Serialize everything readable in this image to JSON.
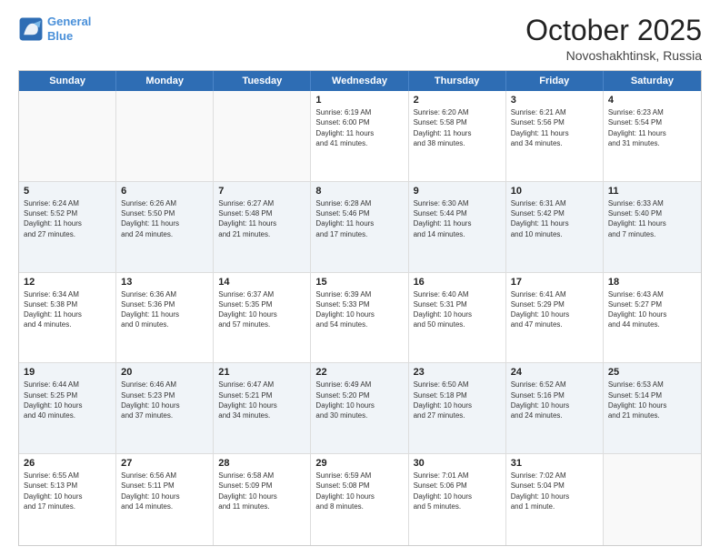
{
  "header": {
    "logo_line1": "General",
    "logo_line2": "Blue",
    "month": "October 2025",
    "location": "Novoshakhtinsk, Russia"
  },
  "day_headers": [
    "Sunday",
    "Monday",
    "Tuesday",
    "Wednesday",
    "Thursday",
    "Friday",
    "Saturday"
  ],
  "weeks": [
    {
      "alt": false,
      "days": [
        {
          "date": "",
          "info": ""
        },
        {
          "date": "",
          "info": ""
        },
        {
          "date": "",
          "info": ""
        },
        {
          "date": "1",
          "info": "Sunrise: 6:19 AM\nSunset: 6:00 PM\nDaylight: 11 hours\nand 41 minutes."
        },
        {
          "date": "2",
          "info": "Sunrise: 6:20 AM\nSunset: 5:58 PM\nDaylight: 11 hours\nand 38 minutes."
        },
        {
          "date": "3",
          "info": "Sunrise: 6:21 AM\nSunset: 5:56 PM\nDaylight: 11 hours\nand 34 minutes."
        },
        {
          "date": "4",
          "info": "Sunrise: 6:23 AM\nSunset: 5:54 PM\nDaylight: 11 hours\nand 31 minutes."
        }
      ]
    },
    {
      "alt": true,
      "days": [
        {
          "date": "5",
          "info": "Sunrise: 6:24 AM\nSunset: 5:52 PM\nDaylight: 11 hours\nand 27 minutes."
        },
        {
          "date": "6",
          "info": "Sunrise: 6:26 AM\nSunset: 5:50 PM\nDaylight: 11 hours\nand 24 minutes."
        },
        {
          "date": "7",
          "info": "Sunrise: 6:27 AM\nSunset: 5:48 PM\nDaylight: 11 hours\nand 21 minutes."
        },
        {
          "date": "8",
          "info": "Sunrise: 6:28 AM\nSunset: 5:46 PM\nDaylight: 11 hours\nand 17 minutes."
        },
        {
          "date": "9",
          "info": "Sunrise: 6:30 AM\nSunset: 5:44 PM\nDaylight: 11 hours\nand 14 minutes."
        },
        {
          "date": "10",
          "info": "Sunrise: 6:31 AM\nSunset: 5:42 PM\nDaylight: 11 hours\nand 10 minutes."
        },
        {
          "date": "11",
          "info": "Sunrise: 6:33 AM\nSunset: 5:40 PM\nDaylight: 11 hours\nand 7 minutes."
        }
      ]
    },
    {
      "alt": false,
      "days": [
        {
          "date": "12",
          "info": "Sunrise: 6:34 AM\nSunset: 5:38 PM\nDaylight: 11 hours\nand 4 minutes."
        },
        {
          "date": "13",
          "info": "Sunrise: 6:36 AM\nSunset: 5:36 PM\nDaylight: 11 hours\nand 0 minutes."
        },
        {
          "date": "14",
          "info": "Sunrise: 6:37 AM\nSunset: 5:35 PM\nDaylight: 10 hours\nand 57 minutes."
        },
        {
          "date": "15",
          "info": "Sunrise: 6:39 AM\nSunset: 5:33 PM\nDaylight: 10 hours\nand 54 minutes."
        },
        {
          "date": "16",
          "info": "Sunrise: 6:40 AM\nSunset: 5:31 PM\nDaylight: 10 hours\nand 50 minutes."
        },
        {
          "date": "17",
          "info": "Sunrise: 6:41 AM\nSunset: 5:29 PM\nDaylight: 10 hours\nand 47 minutes."
        },
        {
          "date": "18",
          "info": "Sunrise: 6:43 AM\nSunset: 5:27 PM\nDaylight: 10 hours\nand 44 minutes."
        }
      ]
    },
    {
      "alt": true,
      "days": [
        {
          "date": "19",
          "info": "Sunrise: 6:44 AM\nSunset: 5:25 PM\nDaylight: 10 hours\nand 40 minutes."
        },
        {
          "date": "20",
          "info": "Sunrise: 6:46 AM\nSunset: 5:23 PM\nDaylight: 10 hours\nand 37 minutes."
        },
        {
          "date": "21",
          "info": "Sunrise: 6:47 AM\nSunset: 5:21 PM\nDaylight: 10 hours\nand 34 minutes."
        },
        {
          "date": "22",
          "info": "Sunrise: 6:49 AM\nSunset: 5:20 PM\nDaylight: 10 hours\nand 30 minutes."
        },
        {
          "date": "23",
          "info": "Sunrise: 6:50 AM\nSunset: 5:18 PM\nDaylight: 10 hours\nand 27 minutes."
        },
        {
          "date": "24",
          "info": "Sunrise: 6:52 AM\nSunset: 5:16 PM\nDaylight: 10 hours\nand 24 minutes."
        },
        {
          "date": "25",
          "info": "Sunrise: 6:53 AM\nSunset: 5:14 PM\nDaylight: 10 hours\nand 21 minutes."
        }
      ]
    },
    {
      "alt": false,
      "days": [
        {
          "date": "26",
          "info": "Sunrise: 6:55 AM\nSunset: 5:13 PM\nDaylight: 10 hours\nand 17 minutes."
        },
        {
          "date": "27",
          "info": "Sunrise: 6:56 AM\nSunset: 5:11 PM\nDaylight: 10 hours\nand 14 minutes."
        },
        {
          "date": "28",
          "info": "Sunrise: 6:58 AM\nSunset: 5:09 PM\nDaylight: 10 hours\nand 11 minutes."
        },
        {
          "date": "29",
          "info": "Sunrise: 6:59 AM\nSunset: 5:08 PM\nDaylight: 10 hours\nand 8 minutes."
        },
        {
          "date": "30",
          "info": "Sunrise: 7:01 AM\nSunset: 5:06 PM\nDaylight: 10 hours\nand 5 minutes."
        },
        {
          "date": "31",
          "info": "Sunrise: 7:02 AM\nSunset: 5:04 PM\nDaylight: 10 hours\nand 1 minute."
        },
        {
          "date": "",
          "info": ""
        }
      ]
    }
  ]
}
